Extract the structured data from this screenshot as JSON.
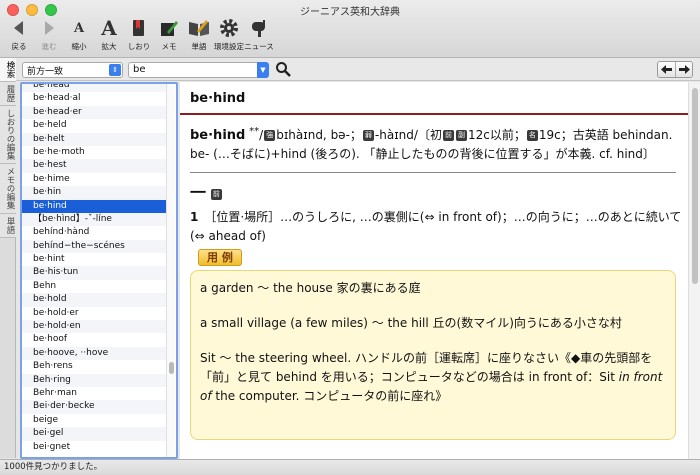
{
  "window": {
    "title": "ジーニアス英和大辞典"
  },
  "toolbar": [
    {
      "id": "back",
      "label": "戻る",
      "icon": "back-arrow-icon",
      "disabled": false
    },
    {
      "id": "forward",
      "label": "進む",
      "icon": "forward-arrow-icon",
      "disabled": true
    },
    {
      "id": "shrink",
      "label": "縮小",
      "icon": "shrink-text-icon",
      "disabled": false
    },
    {
      "id": "enlarge",
      "label": "拡大",
      "icon": "enlarge-text-icon",
      "disabled": false
    },
    {
      "id": "bookmark",
      "label": "しおり",
      "icon": "bookmark-icon",
      "disabled": false
    },
    {
      "id": "memo",
      "label": "メモ",
      "icon": "memo-pencil-icon",
      "disabled": false
    },
    {
      "id": "wordbook",
      "label": "単語",
      "icon": "wordbook-icon",
      "disabled": false
    },
    {
      "id": "settings",
      "label": "環境設定",
      "icon": "gear-icon",
      "disabled": false
    },
    {
      "id": "news",
      "label": "ニュース",
      "icon": "mailbox-icon",
      "disabled": false
    }
  ],
  "side_tabs": [
    "検索",
    "履歴",
    "しおりの編集",
    "メモの編集",
    "単語"
  ],
  "search": {
    "mode": "前方一致",
    "query": "be"
  },
  "word_list": {
    "items": [
      "be·head",
      "be·head·al",
      "be·head·er",
      "be·held",
      "be·helt",
      "be·he·moth",
      "be·hest",
      "be·hime",
      "be·hin",
      "be·hind",
      "【be·hìnd】-ˇ-líne",
      "behínd·hànd",
      "behínd−the−scénes",
      "be·hint",
      "Be·his·tun",
      "Behn",
      "be·hold",
      "be·hold·er",
      "be·hold·en",
      "be·hoof",
      "be·hoove, ··hove",
      "Beh·rens",
      "Beh·ring",
      "Behr·man",
      "Bei·der·becke",
      "beige",
      "bei·gel",
      "bei·gnet"
    ],
    "selected_index": 9
  },
  "entry": {
    "headword": "be·hind",
    "head_bold": "be·hind",
    "stars": "**",
    "pron1": "bɪhàɪnd, bə-",
    "tag_strong": "強",
    "tag_weak": "弱",
    "pron2": "-hàɪnd/",
    "ety_text1": "〔初",
    "tag_pre": "前",
    "tag_adv": "副",
    "ety_text2": "12c以前；",
    "tag_noun": "名",
    "ety_text3": "19c；古英語 behindan. be- (…そばに)+hind (後ろの). 「静止したものの背後に位置する」が本義. cf. hind〕",
    "pos_symbol": "一",
    "pos_tag": "前",
    "sense_num": "1",
    "sense_text": "［位置·場所］…のうしろに, …の裏側に(⇔ in front of)；…の向うに；…のあとに続いて(⇔ ahead of)",
    "examples_label": "用 例",
    "examples": [
      {
        "text": "a garden 〜 the house 家の裏にある庭"
      },
      {
        "text": "a small village (a few miles) 〜 the hill 丘の(数マイル)向うにある小さな村"
      },
      {
        "pre": "Sit 〜 the steering wheel. ハンドルの前［運転席］に座りなさい《◆車の先頭部を「前」と見て behind を用いる；コンピュータなどの場合は in front of：Sit ",
        "em": "in front of",
        "post": " the computer. コンピュータの前に座れ》"
      }
    ]
  },
  "status": {
    "text": "1000件見つかりました。"
  },
  "colors": {
    "accent_blue": "#1a5ed8",
    "rule_red": "#8b1e1e",
    "example_bg": "#fff9d8"
  }
}
